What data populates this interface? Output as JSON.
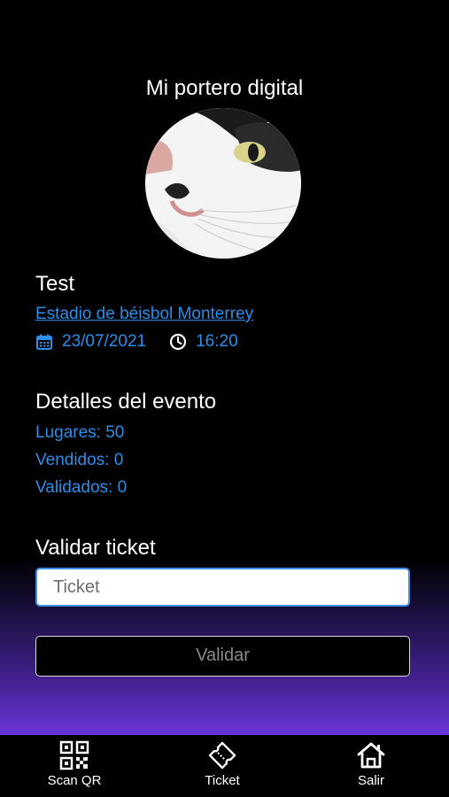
{
  "header": {
    "title": "Mi portero digital"
  },
  "avatar": {
    "icon": "cat-photo"
  },
  "event": {
    "name": "Test",
    "venue": "Estadio de béisbol Monterrey",
    "date": "23/07/2021",
    "time": "16:20",
    "date_icon": "calendar-icon",
    "time_icon": "clock-icon"
  },
  "details": {
    "title": "Detalles del evento",
    "places": "Lugares: 50",
    "sold": "Vendidos: 0",
    "validated": "Validados: 0"
  },
  "validate": {
    "title": "Validar ticket",
    "input_placeholder": "Ticket",
    "input_value": "",
    "button_label": "Validar"
  },
  "tabs": [
    {
      "label": "Scan QR",
      "icon": "qr-code-icon"
    },
    {
      "label": "Ticket",
      "icon": "ticket-icon"
    },
    {
      "label": "Salir",
      "icon": "home-icon"
    }
  ],
  "colors": {
    "accent": "#2b8ee8",
    "background": "#000000",
    "gradient_end": "#6a35d8"
  }
}
